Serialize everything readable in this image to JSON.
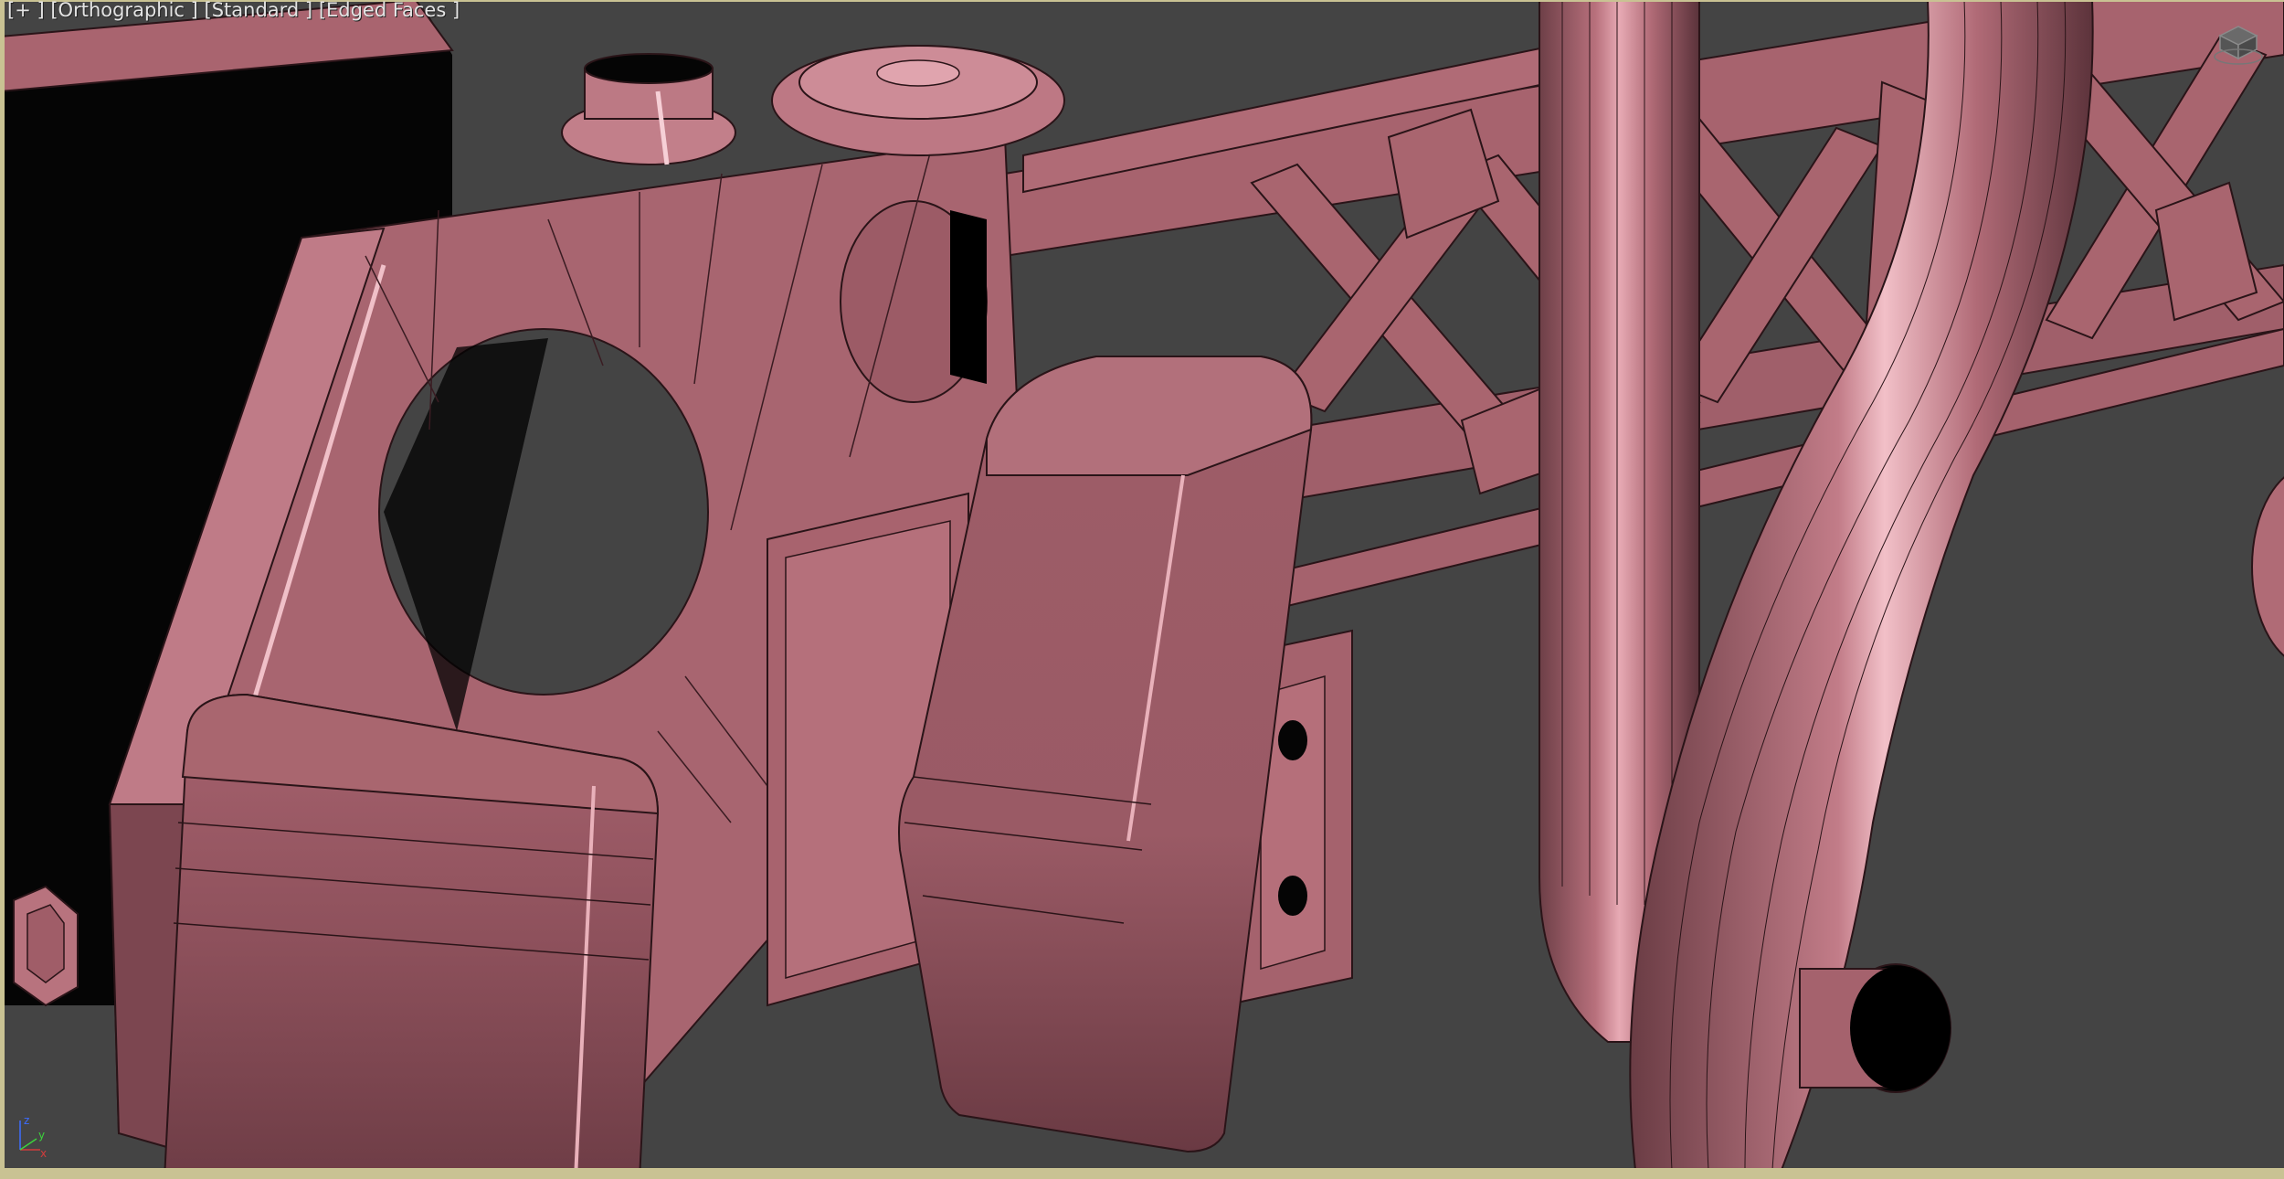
{
  "viewport": {
    "labels": {
      "menu": "[+ ]",
      "view": "[Orthographic ]",
      "shading": "[Standard ]",
      "display": "[Edged Faces ]"
    },
    "axis": {
      "x": "x",
      "y": "y",
      "z": "z"
    },
    "colors": {
      "background": "#444444",
      "model": "#b46e7a",
      "border": "#c9c293"
    }
  }
}
